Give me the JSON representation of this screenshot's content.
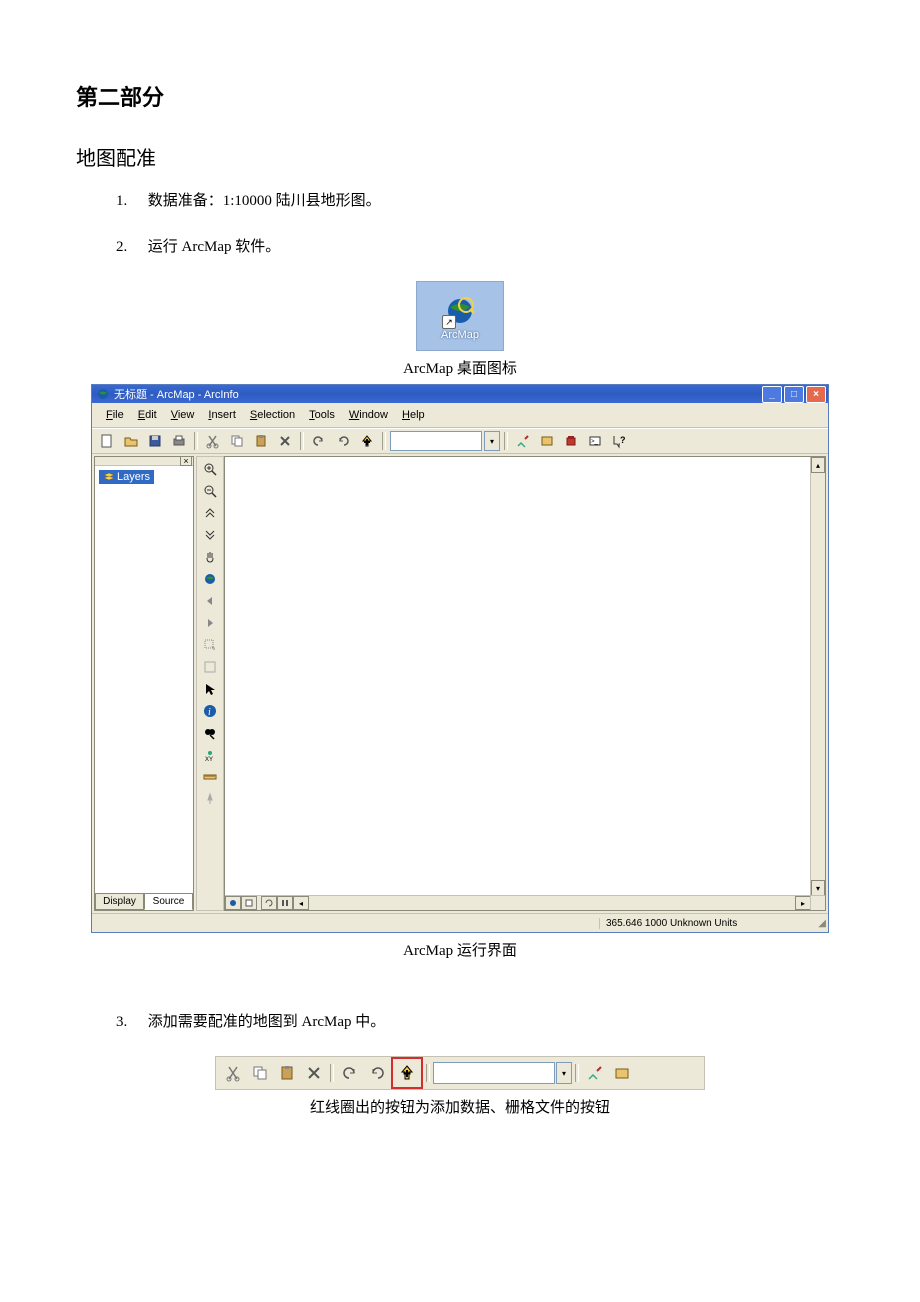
{
  "doc": {
    "section_title": "第二部分",
    "sub_title": "地图配准",
    "list": [
      {
        "num": "1.",
        "text": "数据准备：1:10000 陆川县地形图。"
      },
      {
        "num": "2.",
        "text": "运行 ArcMap 软件。"
      },
      {
        "num": "3.",
        "text": "添加需要配准的地图到 ArcMap 中。"
      }
    ],
    "caption_desktop_icon": "ArcMap 桌面图标",
    "caption_main_window": "ArcMap 运行界面",
    "caption_add_data": "红线圈出的按钮为添加数据、栅格文件的按钮",
    "desktop_icon_label": "ArcMap"
  },
  "app": {
    "window_title": "无标题 - ArcMap - ArcInfo",
    "menus": [
      "File",
      "Edit",
      "View",
      "Insert",
      "Selection",
      "Tools",
      "Window",
      "Help"
    ],
    "layers_root": "Layers",
    "left_tabs": {
      "display": "Display",
      "source": "Source"
    },
    "status_coords": "365.646  1000 Unknown Units"
  }
}
